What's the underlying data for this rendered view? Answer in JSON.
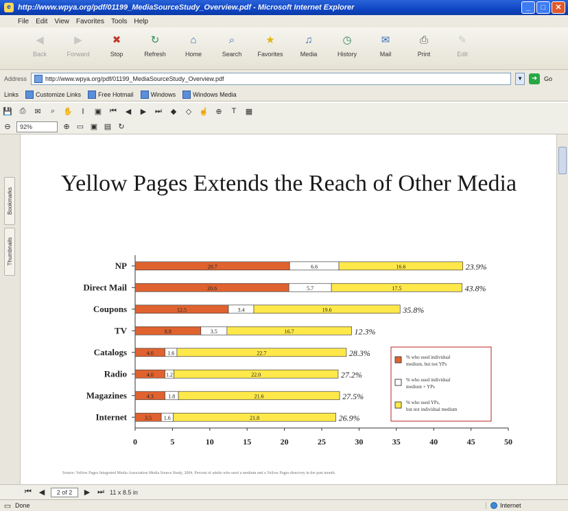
{
  "window": {
    "title": "http://www.wpya.org/pdf/01199_MediaSourceStudy_Overview.pdf - Microsoft Internet Explorer",
    "minimize": "_",
    "maximize": "□",
    "close": "✕"
  },
  "menu": [
    "File",
    "Edit",
    "View",
    "Favorites",
    "Tools",
    "Help"
  ],
  "toolbar": {
    "buttons": [
      {
        "label": "Back",
        "icon": "back-arrow-icon",
        "glyph": "◀",
        "color": "#9a9a9a",
        "disabled": true
      },
      {
        "label": "Forward",
        "icon": "forward-arrow-icon",
        "glyph": "▶",
        "color": "#9a9a9a",
        "disabled": true
      },
      {
        "label": "Stop",
        "icon": "stop-icon",
        "glyph": "✖",
        "color": "#c0392b",
        "disabled": false
      },
      {
        "label": "Refresh",
        "icon": "refresh-icon",
        "glyph": "↻",
        "color": "#2e8b57",
        "disabled": false
      },
      {
        "label": "Home",
        "icon": "home-icon",
        "glyph": "⌂",
        "color": "#3b6fb6",
        "disabled": false
      },
      {
        "label": "Search",
        "icon": "search-icon",
        "glyph": "⌕",
        "color": "#3b6fb6",
        "disabled": false
      },
      {
        "label": "Favorites",
        "icon": "favorites-star-icon",
        "glyph": "★",
        "color": "#e2b411",
        "disabled": false
      },
      {
        "label": "Media",
        "icon": "media-icon",
        "glyph": "♫",
        "color": "#3b6fb6",
        "disabled": false
      },
      {
        "label": "History",
        "icon": "history-icon",
        "glyph": "◷",
        "color": "#2e8b57",
        "disabled": false
      },
      {
        "label": "Mail",
        "icon": "mail-icon",
        "glyph": "✉",
        "color": "#3b6fb6",
        "disabled": false
      },
      {
        "label": "Print",
        "icon": "print-icon",
        "glyph": "⎙",
        "color": "#555555",
        "disabled": false
      },
      {
        "label": "Edit",
        "icon": "edit-icon",
        "glyph": "✎",
        "color": "#9a9a9a",
        "disabled": true
      }
    ]
  },
  "address": {
    "label": "Address",
    "url": "http://www.wpya.org/pdf/01199_MediaSourceStudy_Overview.pdf",
    "go_label": "Go"
  },
  "links": {
    "label": "Links",
    "items": [
      "Customize Links",
      "Free Hotmail",
      "Windows",
      "Windows Media"
    ]
  },
  "pdf": {
    "zoom": "92%",
    "page_indicator": "2 of 2",
    "page_size": "11 x 8.5 in",
    "side_tabs": [
      "Bookmarks",
      "Thumbnails"
    ]
  },
  "document": {
    "title": "Yellow Pages Extends the Reach of Other Media",
    "footnote": "Source: Yellow Pages Integrated Media Association Media Source Study, 2004. Percent of adults who used a medium and a Yellow Pages directory in the past month."
  },
  "chart_data": {
    "type": "bar",
    "stacked": true,
    "orientation": "horizontal",
    "categories": [
      "NP",
      "Direct Mail",
      "Coupons",
      "TV",
      "Catalogs",
      "Radio",
      "Magazines",
      "Internet"
    ],
    "series": [
      {
        "name": "% who used individual medium, but not YPs",
        "color": "#e0622f",
        "values": [
          20.7,
          20.6,
          12.5,
          8.8,
          4.0,
          4.0,
          4.0,
          3.5
        ],
        "labels": [
          "20.7",
          "20.6",
          "12.5",
          "8.8",
          "4.0",
          "4.0",
          "4.3",
          "3.5"
        ]
      },
      {
        "name": "% who used individual medium + YPs",
        "color": "#ffffff",
        "values": [
          6.6,
          5.7,
          3.4,
          3.5,
          1.6,
          1.2,
          1.8,
          1.6
        ],
        "labels": [
          "6.6",
          "5.7",
          "3.4",
          "3.5",
          "1.6",
          "1.2",
          "1.8",
          "1.6"
        ]
      },
      {
        "name": "% who used YPs, but not individual medium",
        "color": "#ffe84a",
        "values": [
          16.6,
          17.5,
          19.6,
          16.7,
          22.7,
          22.0,
          21.6,
          21.8
        ],
        "labels": [
          "16.6",
          "17.5",
          "19.6",
          "16.7",
          "22.7",
          "22.0",
          "21.6",
          "21.8"
        ]
      }
    ],
    "totals": [
      "23.9%",
      "43.8%",
      "35.8%",
      "12.3%",
      "28.3%",
      "27.2%",
      "27.5%",
      "26.9%"
    ],
    "xaxis": {
      "ticks": [
        0,
        5,
        10,
        15,
        20,
        25,
        30,
        35,
        40,
        45,
        50
      ],
      "range": [
        0,
        50
      ]
    },
    "grid": false,
    "legend_placement": "right",
    "legend": [
      "% who used individual medium, but not YPs",
      "% who used individual medium + YPs",
      "% who used YPs, but not individual medium"
    ]
  },
  "pdfnav": {
    "first": "⏮",
    "prev": "◀",
    "next": "▶",
    "last": "⏭"
  },
  "status": {
    "left": "Done",
    "zone": "Internet"
  }
}
